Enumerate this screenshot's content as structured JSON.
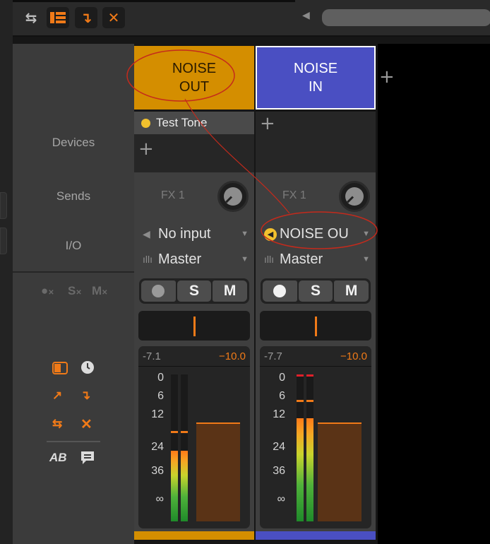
{
  "toolbar": {
    "buttons": [
      {
        "name": "swap-arrows-icon",
        "glyph": "⇆"
      },
      {
        "name": "mixer-layout-icon",
        "glyph": ""
      },
      {
        "name": "arrow-down-right-icon",
        "glyph": "↴"
      },
      {
        "name": "close-x-icon",
        "glyph": "✕"
      }
    ],
    "scroll_left_glyph": "◀"
  },
  "labels": {
    "devices": "Devices",
    "sends": "Sends",
    "io": "I/O",
    "mute_solo_icons": [
      "R",
      "S",
      "M"
    ],
    "ab": "AB"
  },
  "add_track_glyph": "+",
  "tracks": [
    {
      "id": "noise-out",
      "name_line1": "NOISE",
      "name_line2": "OUT",
      "header_color": "#d48e00",
      "text_color": "#2a1a00",
      "devices": [
        {
          "name": "Test Tone",
          "dot_color": "#f2c12e"
        }
      ],
      "add_device": "+",
      "fx_label": "FX 1",
      "input": "No input",
      "output": "Master",
      "buttons": {
        "record": "",
        "solo": "S",
        "mute": "M"
      },
      "peak": "-7.1",
      "volume": "−10.0",
      "scale": [
        "0",
        "6",
        "12",
        "24",
        "36",
        "∞"
      ],
      "meter_level_left": 0.48,
      "meter_level_right": 0.48,
      "fader_level": 0.64
    },
    {
      "id": "noise-in",
      "name_line1": "NOISE",
      "name_line2": "IN",
      "header_color": "#4a4fc2",
      "text_color": "#ffffff",
      "devices": [],
      "add_device": "+",
      "fx_label": "FX 1",
      "input": "NOISE OU",
      "output": "Master",
      "buttons": {
        "record": "",
        "solo": "S",
        "mute": "M"
      },
      "peak": "-7.7",
      "volume": "−10.0",
      "scale": [
        "0",
        "6",
        "12",
        "24",
        "36",
        "∞"
      ],
      "meter_level_left": 0.7,
      "meter_level_right": 0.7,
      "fader_level": 0.64
    }
  ],
  "colors": {
    "accent": "#f07a18",
    "annotation": "#c42a1c"
  }
}
